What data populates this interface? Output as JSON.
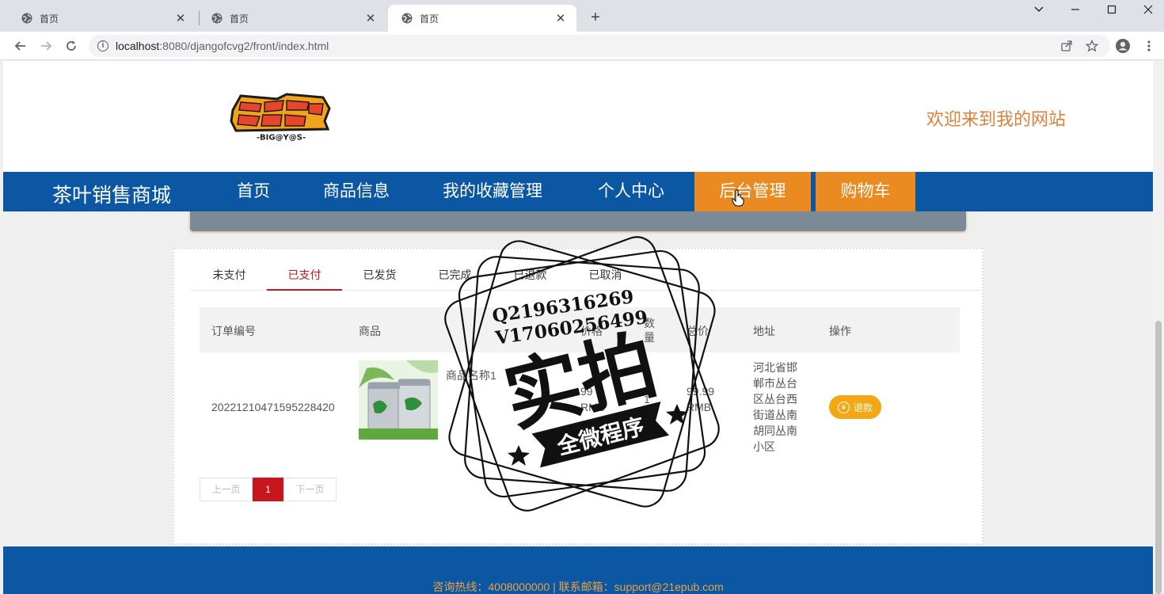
{
  "browser": {
    "tabs": [
      {
        "title": "首页",
        "active": false
      },
      {
        "title": "首页",
        "active": false
      },
      {
        "title": "首页",
        "active": true
      }
    ],
    "new_tab_symbol": "+",
    "url_host": "localhost",
    "url_path": ":8080/djangofcvg2/front/index.html"
  },
  "header": {
    "logo_text": "-BIG@Y@S-",
    "welcome": "欢迎来到我的网站"
  },
  "nav": {
    "brand": "茶叶销售商城",
    "items": [
      "首页",
      "商品信息",
      "我的收藏管理",
      "个人中心",
      "后台管理",
      "购物车"
    ]
  },
  "order_tabs": [
    "未支付",
    "已支付",
    "已发货",
    "已完成",
    "已退款",
    "已取消"
  ],
  "active_order_tab": "已支付",
  "table": {
    "headers": [
      "订单编号",
      "商品",
      "价格",
      "数量",
      "总价",
      "地址",
      "操作"
    ],
    "rows": [
      {
        "order_no": "20221210471595228420",
        "product_name": "商品名称1",
        "price_line1": "99",
        "price_line2": "RMB",
        "quantity": "1",
        "total_line1": "99.99",
        "total_line2": "RMB",
        "address_lines": [
          "河北省邯",
          "郸市丛台",
          "区丛台西",
          "街道丛南",
          "胡同丛南",
          "小区"
        ],
        "action": "退款"
      }
    ]
  },
  "pager": {
    "prev": "上一页",
    "current": "1",
    "next": "下一页"
  },
  "footer": {
    "contact": "咨询热线：4008000000 | 联系邮箱：support@21epub.com"
  },
  "watermark": {
    "line1": "Q2196316269",
    "line2": "V17060256499",
    "big": "实拍",
    "banner": "全微程序"
  },
  "colors": {
    "nav_blue": "#0b57a4",
    "nav_orange": "#ea8a21",
    "accent_red": "#c8161d",
    "refund_yellow": "#f3a712",
    "welcome_orange": "#d9803a"
  }
}
